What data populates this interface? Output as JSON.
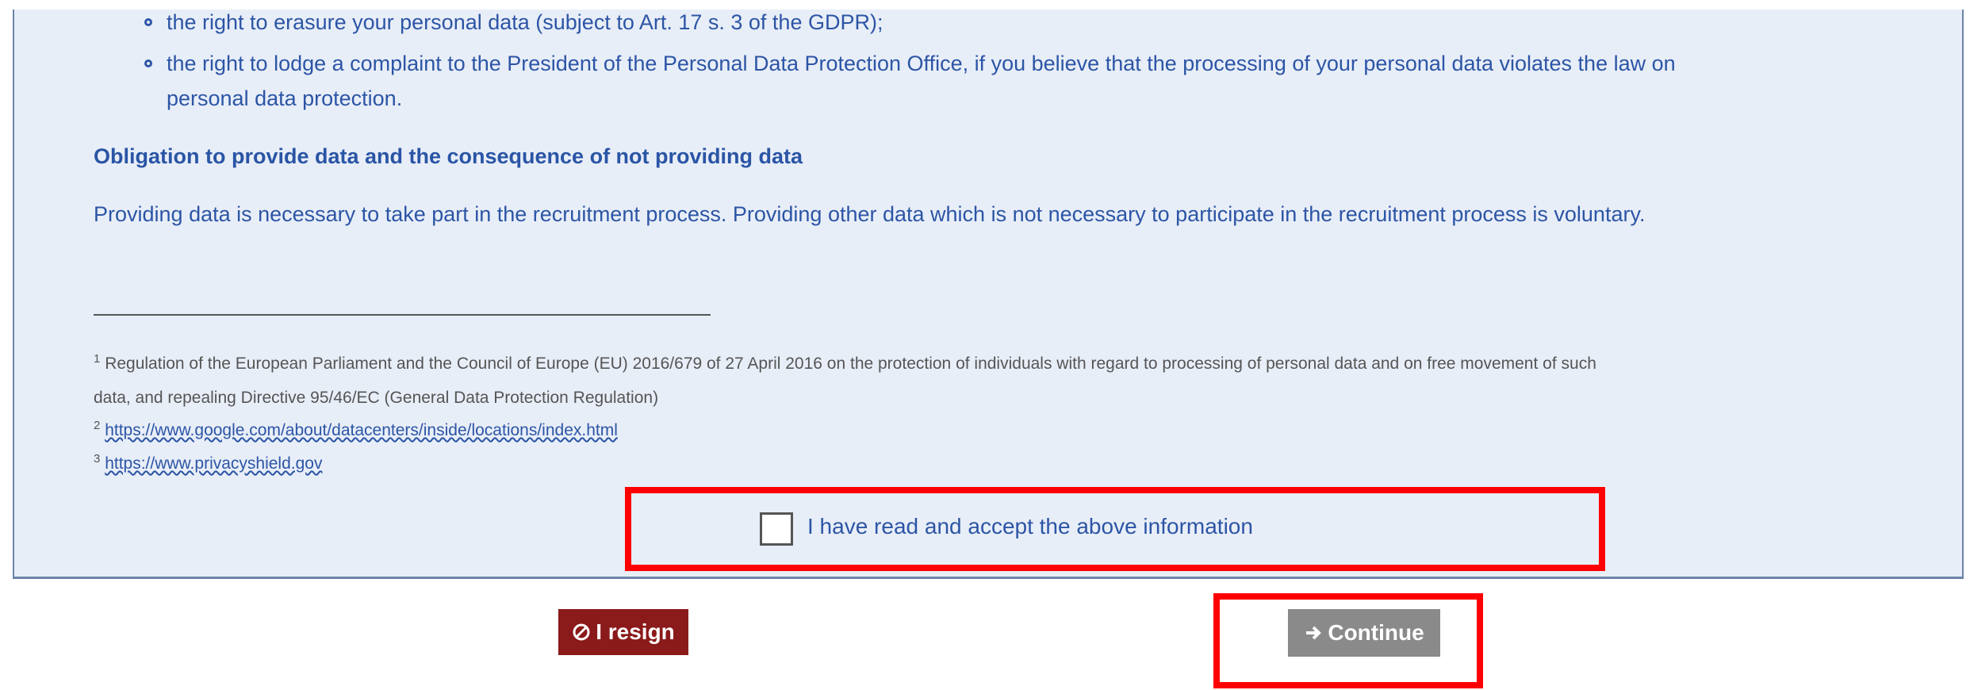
{
  "rights": {
    "erasure": "the right to erasure your personal data (subject to Art. 17 s. 3 of the GDPR);",
    "complaint_line1": "the right to lodge a complaint to the President of the Personal Data Protection Office, if you believe that the processing of your personal data violates the law on",
    "complaint_line2": "personal data protection."
  },
  "obligation": {
    "heading": "Obligation to provide data and the consequence of not providing data",
    "text": "Providing data is necessary to take part in the recruitment process. Providing other data which is not necessary to participate in the recruitment process is voluntary."
  },
  "footnotes": {
    "n1": "1",
    "text1_line1": "Regulation of the European Parliament and the Council of Europe (EU) 2016/679 of 27 April 2016 on the protection of individuals with regard to processing of personal data and on free movement of such",
    "text1_line2": "data, and repealing Directive 95/46/EC (General Data Protection Regulation)",
    "n2": "2",
    "link2": "https://www.google.com/about/datacenters/inside/locations/index.html",
    "n3": "3",
    "link3": "https://www.privacyshield.gov"
  },
  "consent": {
    "label": "I have read and accept the above information",
    "checked": false
  },
  "buttons": {
    "resign_label": "I resign",
    "resign_icon": "ban-icon",
    "continue_label": "Continue",
    "continue_icon": "arrow-right-icon"
  },
  "colors": {
    "panel_bg": "#e8eef8",
    "text_blue": "#2c55a5",
    "resign_bg": "#8b1a1a",
    "continue_bg": "#8a8a8a",
    "highlight": "#ff0000"
  }
}
